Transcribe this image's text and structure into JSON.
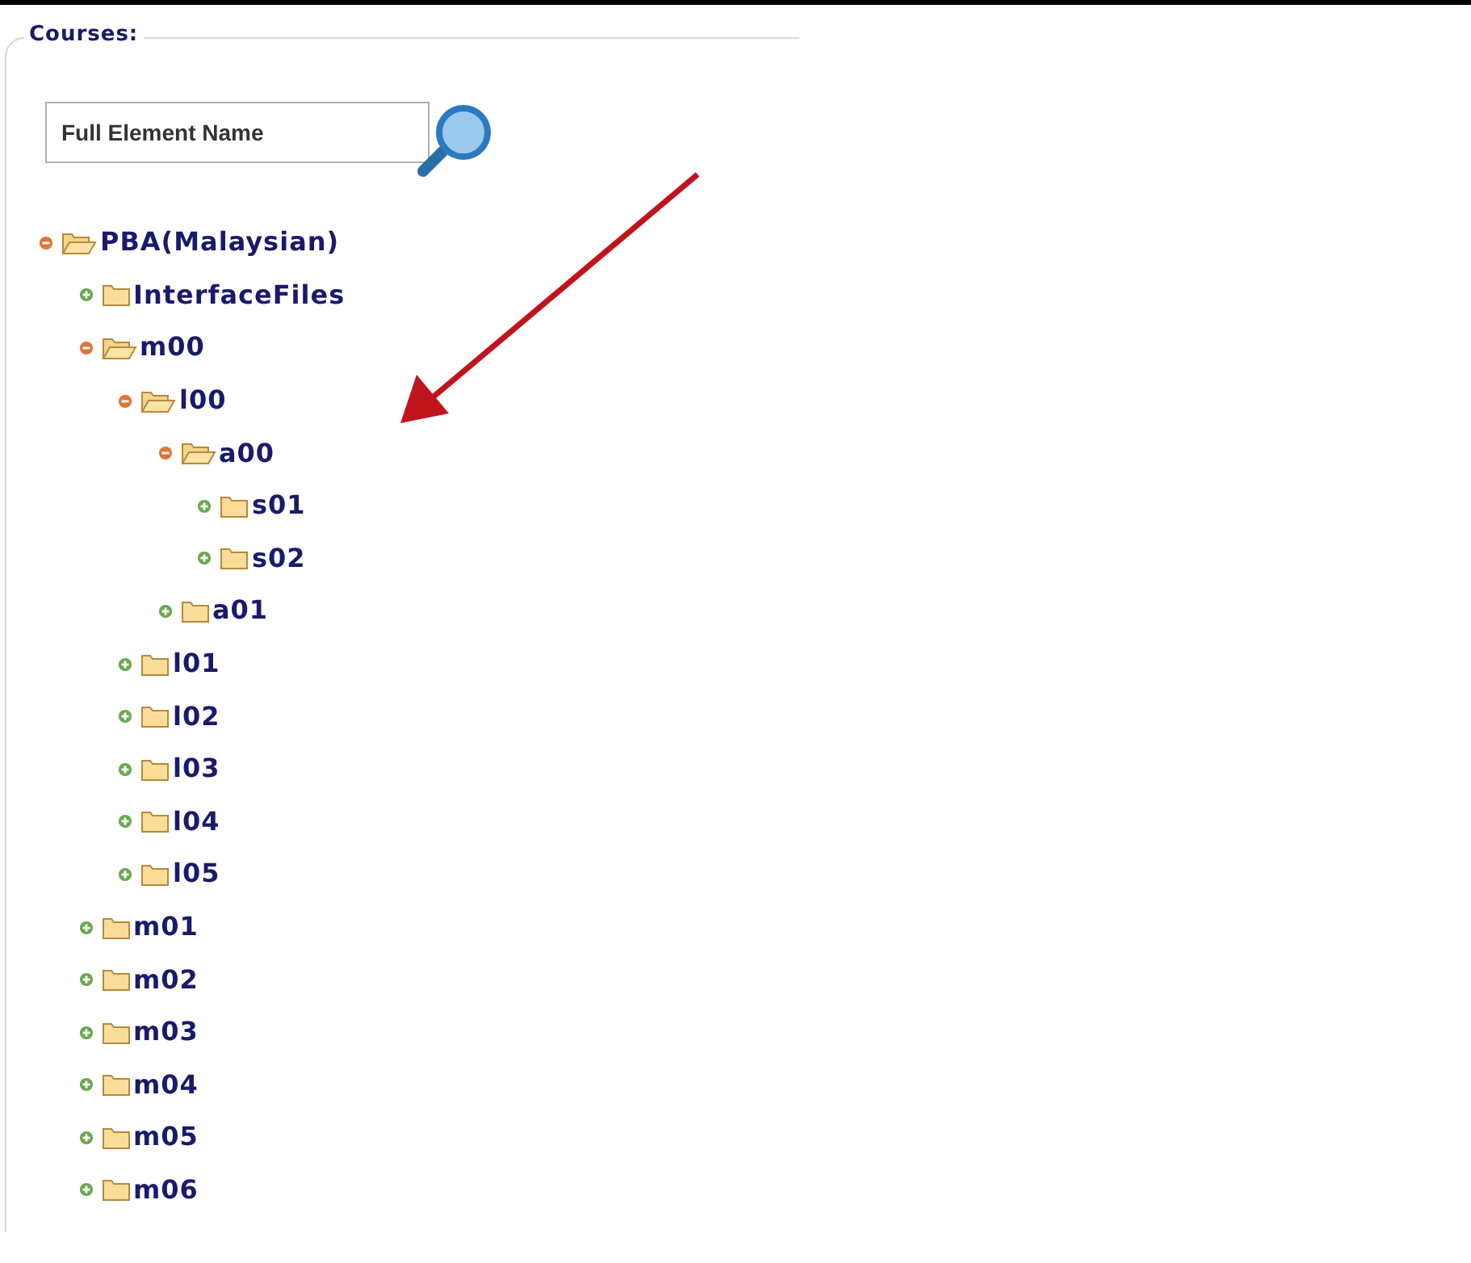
{
  "panel": {
    "title": "Courses:"
  },
  "search": {
    "placeholder": "Full Element Name"
  },
  "tree": [
    {
      "label": "PBA(Malaysian)",
      "expanded": true,
      "children": [
        {
          "label": "InterfaceFiles",
          "expanded": false
        },
        {
          "label": "m00",
          "expanded": true,
          "children": [
            {
              "label": "l00",
              "expanded": true,
              "children": [
                {
                  "label": "a00",
                  "expanded": true,
                  "children": [
                    {
                      "label": "s01",
                      "expanded": false
                    },
                    {
                      "label": "s02",
                      "expanded": false
                    }
                  ]
                },
                {
                  "label": "a01",
                  "expanded": false
                }
              ]
            },
            {
              "label": "l01",
              "expanded": false
            },
            {
              "label": "l02",
              "expanded": false
            },
            {
              "label": "l03",
              "expanded": false
            },
            {
              "label": "l04",
              "expanded": false
            },
            {
              "label": "l05",
              "expanded": false
            }
          ]
        },
        {
          "label": "m01",
          "expanded": false
        },
        {
          "label": "m02",
          "expanded": false
        },
        {
          "label": "m03",
          "expanded": false
        },
        {
          "label": "m04",
          "expanded": false
        },
        {
          "label": "m05",
          "expanded": false
        },
        {
          "label": "m06",
          "expanded": false
        }
      ]
    }
  ]
}
